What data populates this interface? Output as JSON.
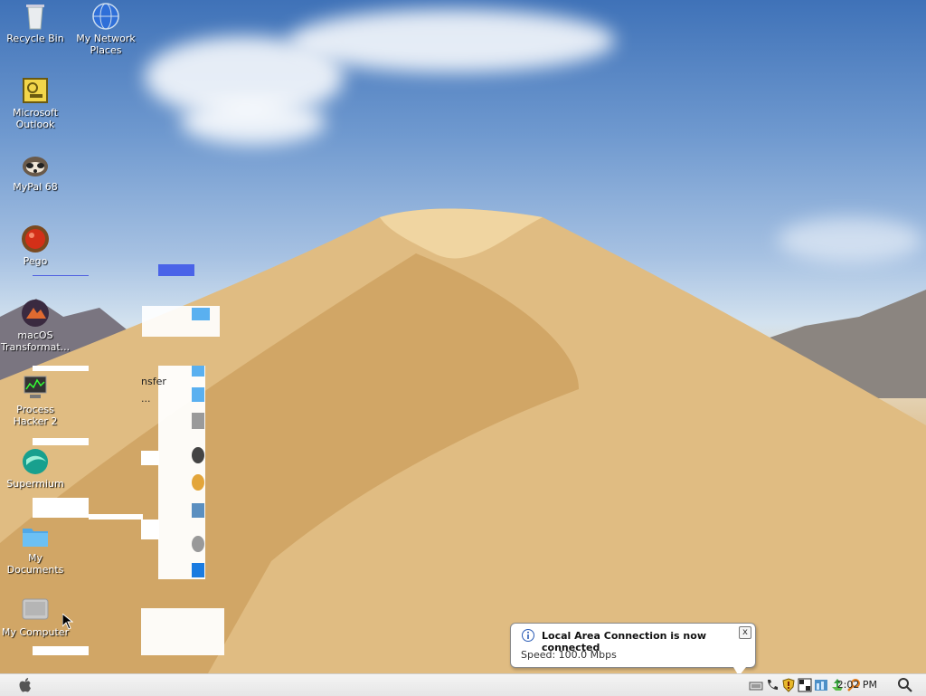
{
  "desktop_icons": [
    {
      "label": "Recycle Bin",
      "icon": "recycle-bin-icon"
    },
    {
      "label": "My Network Places",
      "icon": "network-globe-icon"
    },
    {
      "label": "Microsoft Outlook",
      "icon": "outlook-icon"
    },
    {
      "label": "MyPal 68",
      "icon": "mypal-raccoon-icon"
    },
    {
      "label": "Pego",
      "icon": "pego-red-ball-icon"
    },
    {
      "label": "macOS Transformat...",
      "icon": "macos-transformation-icon"
    },
    {
      "label": "Process Hacker 2",
      "icon": "process-hacker-icon"
    },
    {
      "label": "Supermium",
      "icon": "supermium-icon"
    },
    {
      "label": "My Documents",
      "icon": "folder-icon"
    },
    {
      "label": "My Computer",
      "icon": "computer-icon"
    }
  ],
  "ghost_text": {
    "transfer": "nsfer ..."
  },
  "notification": {
    "title": "Local Area Connection is now connected",
    "message": "Speed: 100.0 Mbps",
    "close_label": "x"
  },
  "taskbar": {
    "clock": "2:02 PM",
    "tray_icons": [
      "keyboard-icon",
      "phone-icon",
      "shield-icon",
      "grid-icon",
      "network-monitor-icon",
      "recycle-green-icon",
      "search-key-icon"
    ]
  },
  "colors": {
    "sky": "#6f99cf",
    "sand": "#d9b37b",
    "taskbar": "#ececec",
    "balloon_border": "#8a8a8a"
  }
}
